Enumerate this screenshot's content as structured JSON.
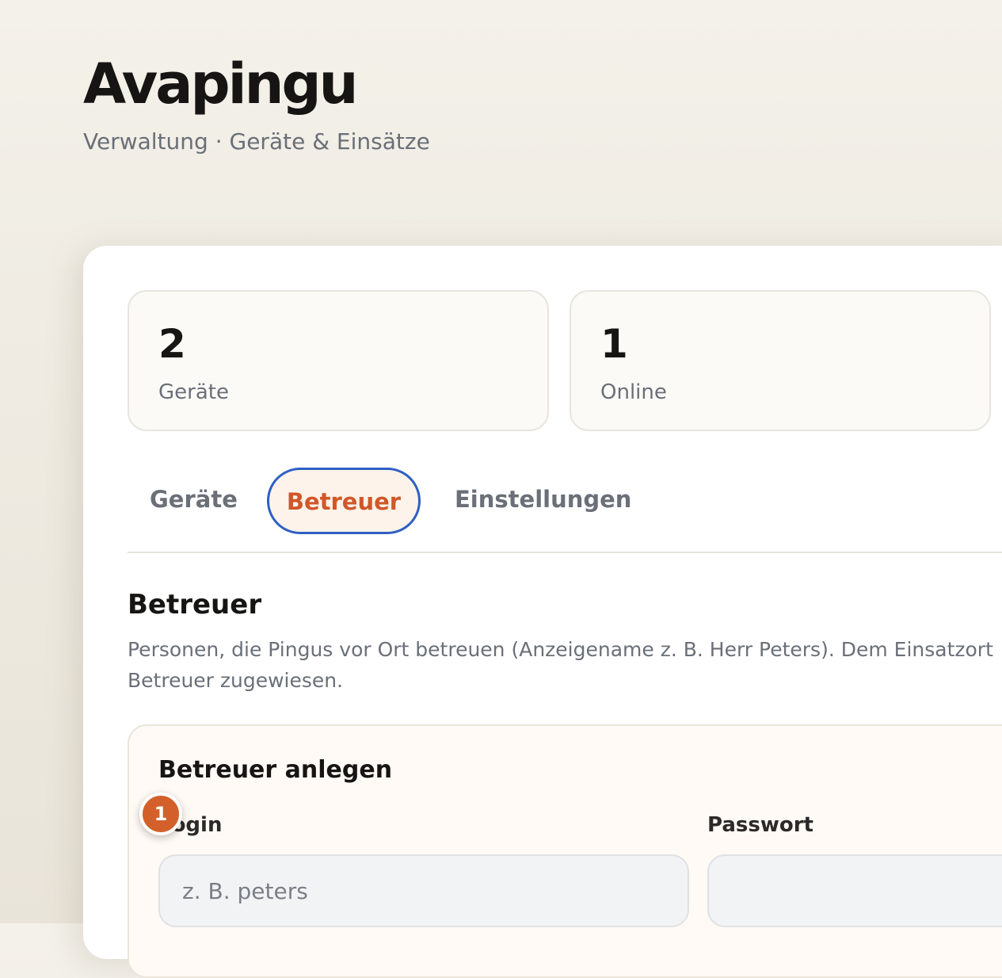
{
  "header": {
    "title": "Avapingu",
    "subtitle": "Verwaltung · Geräte & Einsätze"
  },
  "stats": [
    {
      "value": "2",
      "label": "Geräte"
    },
    {
      "value": "1",
      "label": "Online"
    }
  ],
  "tabs": [
    {
      "label": "Geräte",
      "active": false
    },
    {
      "label": "Betreuer",
      "active": true
    },
    {
      "label": "Einstellungen",
      "active": false
    }
  ],
  "section": {
    "title": "Betreuer",
    "description": "Personen, die Pingus vor Ort betreuen (Anzeigename z. B. Herr Peters). Dem Einsatzort Betreuer zugewiesen."
  },
  "form": {
    "title": "Betreuer anlegen",
    "login_label": "Login",
    "login_placeholder": "z. B. peters",
    "login_value": "",
    "password_label": "Passwort",
    "password_value": ""
  },
  "step_badge": "1",
  "colors": {
    "accent": "#d3602a",
    "focus_ring": "#2f5fc4",
    "text_primary": "#161514",
    "text_muted": "#6a6f78"
  }
}
